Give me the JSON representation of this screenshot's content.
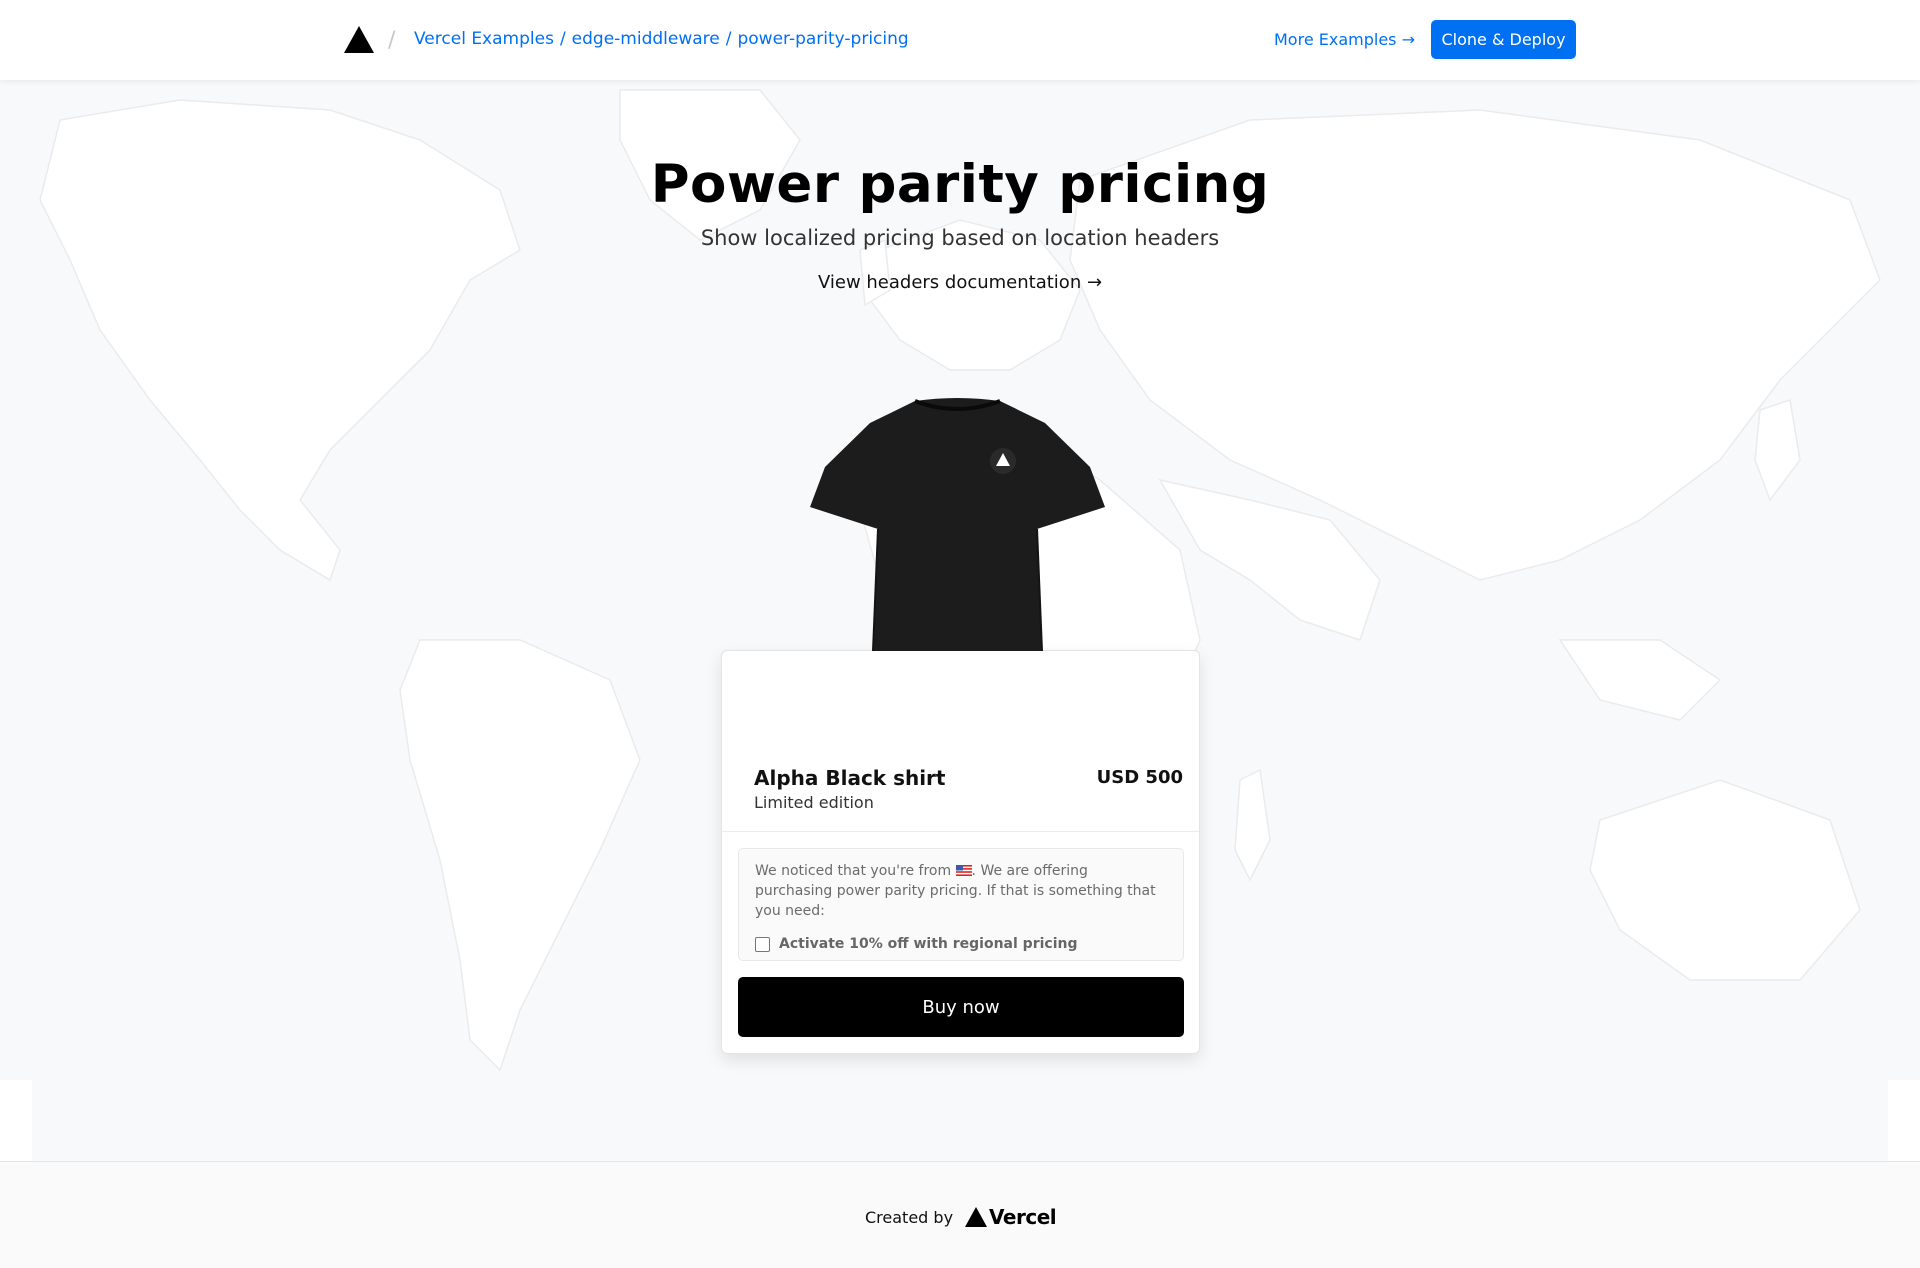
{
  "header": {
    "logo": "vercel-triangle-icon",
    "breadcrumb": [
      "Vercel Examples",
      "edge-middleware",
      "power-parity-pricing"
    ],
    "more_examples": "More Examples →",
    "clone_deploy": "Clone & Deploy"
  },
  "hero": {
    "title": "Power parity pricing",
    "subtitle": "Show localized pricing based on location headers",
    "docs_link": "View headers documentation →"
  },
  "product": {
    "name": "Alpha Black shirt",
    "edition": "Limited edition",
    "price": "USD 500",
    "notice_before_flag": "We noticed that you're from ",
    "notice_after_flag": ". We are offering purchasing power parity pricing. If that is something that you need:",
    "flag": "us-flag-icon",
    "checkbox_label": "Activate 10% off with regional pricing",
    "checkbox_checked": false,
    "buy_label": "Buy now"
  },
  "footer": {
    "created_by": "Created by",
    "brand": "Vercel"
  },
  "colors": {
    "accent": "#0070f3",
    "buy_button": "#000000",
    "background": "#f8f9fa"
  }
}
